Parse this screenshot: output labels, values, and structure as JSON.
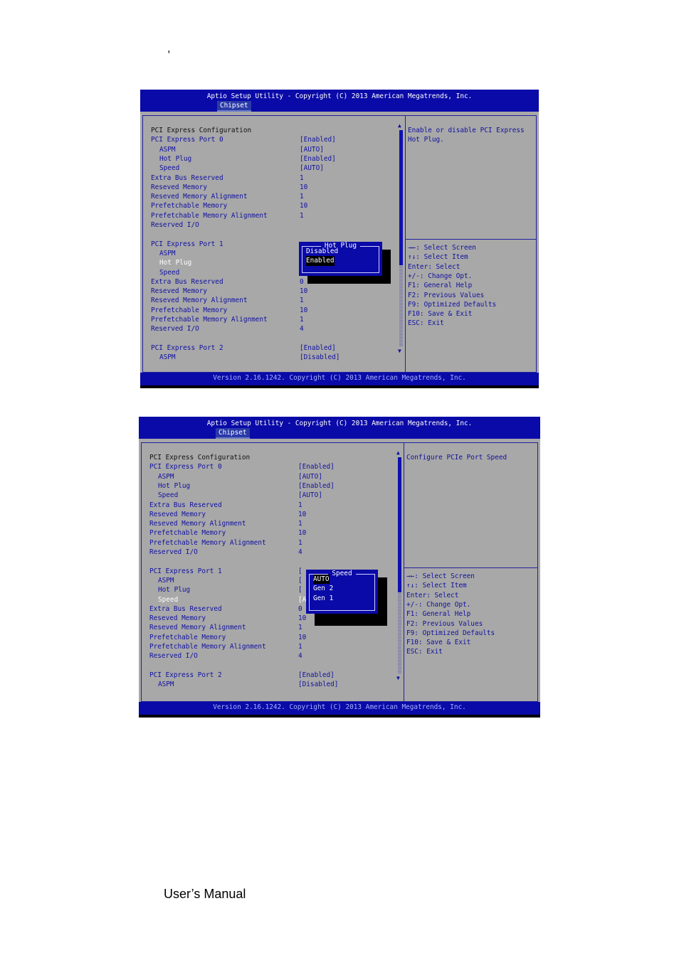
{
  "page": {
    "mark": ",",
    "footer": "User’s Manual"
  },
  "colors": {
    "bios_blue": "#0a0aa8",
    "bios_gray": "#a8a8a8",
    "item_text": "#1010a0",
    "selected_text": "#ffffff"
  },
  "screens": [
    {
      "title": "Aptio Setup Utility - Copyright (C) 2013 American Megatrends, Inc.",
      "tab": "Chipset",
      "footer": "Version 2.16.1242. Copyright (C) 2013 American Megatrends, Inc.",
      "rows": [
        {
          "label": "PCI Express Configuration",
          "value": "",
          "indent": false,
          "title": true
        },
        {
          "label": "PCI Express Port 0",
          "value": "[Enabled]",
          "indent": false
        },
        {
          "label": "ASPM",
          "value": "[AUTO]",
          "indent": true
        },
        {
          "label": "Hot Plug",
          "value": "[Enabled]",
          "indent": true
        },
        {
          "label": "Speed",
          "value": "[AUTO]",
          "indent": true
        },
        {
          "label": "Extra Bus Reserved",
          "value": "1",
          "indent": false
        },
        {
          "label": "Reseved Memory",
          "value": "10",
          "indent": false
        },
        {
          "label": "Reseved Memory Alignment",
          "value": "1",
          "indent": false
        },
        {
          "label": "Prefetchable Memory",
          "value": "10",
          "indent": false
        },
        {
          "label": "Prefetchable Memory Alignment",
          "value": "1",
          "indent": false
        },
        {
          "label": "Reserved I/O",
          "value": "",
          "indent": false
        },
        {
          "label": "",
          "value": "",
          "indent": false
        },
        {
          "label": "PCI Express Port 1",
          "value": "",
          "indent": false
        },
        {
          "label": "ASPM",
          "value": "",
          "indent": true
        },
        {
          "label": "Hot Plug",
          "value": "[",
          "indent": true,
          "selected": true
        },
        {
          "label": "Speed",
          "value": "[AUTO]",
          "indent": true
        },
        {
          "label": "Extra Bus Reserved",
          "value": "0",
          "indent": false
        },
        {
          "label": "Reseved Memory",
          "value": "10",
          "indent": false
        },
        {
          "label": "Reseved Memory Alignment",
          "value": "1",
          "indent": false
        },
        {
          "label": "Prefetchable Memory",
          "value": "10",
          "indent": false
        },
        {
          "label": "Prefetchable Memory Alignment",
          "value": "1",
          "indent": false
        },
        {
          "label": "Reserved I/O",
          "value": "4",
          "indent": false
        },
        {
          "label": "",
          "value": "",
          "indent": false
        },
        {
          "label": "PCI Express Port 2",
          "value": "[Enabled]",
          "indent": false
        },
        {
          "label": "ASPM",
          "value": "[Disabled]",
          "indent": true
        }
      ],
      "help": [
        "Enable or disable PCI Express",
        "Hot Plug."
      ],
      "keys": [
        "→←: Select Screen",
        "↑↓: Select Item",
        "Enter: Select",
        "+/-: Change Opt.",
        "F1: General Help",
        "F2: Previous Values",
        "F9: Optimized Defaults",
        "F10: Save & Exit",
        "ESC: Exit"
      ],
      "popup": {
        "title": "Hot Plug",
        "options": [
          "Disabled",
          "Enabled"
        ],
        "selected": 1
      }
    },
    {
      "title": "Aptio Setup Utility - Copyright (C) 2013 American Megatrends, Inc.",
      "tab": "Chipset",
      "footer": "Version 2.16.1242. Copyright (C) 2013 American Megatrends, Inc.",
      "rows": [
        {
          "label": "PCI Express Configuration",
          "value": "",
          "indent": false,
          "title": true
        },
        {
          "label": "PCI Express Port 0",
          "value": "[Enabled]",
          "indent": false
        },
        {
          "label": "ASPM",
          "value": "[AUTO]",
          "indent": true
        },
        {
          "label": "Hot Plug",
          "value": "[Enabled]",
          "indent": true
        },
        {
          "label": "Speed",
          "value": "[AUTO]",
          "indent": true
        },
        {
          "label": "Extra Bus Reserved",
          "value": "1",
          "indent": false
        },
        {
          "label": "Reseved Memory",
          "value": "10",
          "indent": false
        },
        {
          "label": "Reseved Memory Alignment",
          "value": "1",
          "indent": false
        },
        {
          "label": "Prefetchable Memory",
          "value": "10",
          "indent": false
        },
        {
          "label": "Prefetchable Memory Alignment",
          "value": "1",
          "indent": false
        },
        {
          "label": "Reserved I/O",
          "value": "4",
          "indent": false
        },
        {
          "label": "",
          "value": "",
          "indent": false
        },
        {
          "label": "PCI Express Port 1",
          "value": "[",
          "indent": false
        },
        {
          "label": "ASPM",
          "value": "[",
          "indent": true
        },
        {
          "label": "Hot Plug",
          "value": "[",
          "indent": true
        },
        {
          "label": "Speed",
          "value": "[AU",
          "indent": true,
          "selected": true
        },
        {
          "label": "Extra Bus Reserved",
          "value": "0",
          "indent": false
        },
        {
          "label": "Reseved Memory",
          "value": "10",
          "indent": false
        },
        {
          "label": "Reseved Memory Alignment",
          "value": "1",
          "indent": false
        },
        {
          "label": "Prefetchable Memory",
          "value": "10",
          "indent": false
        },
        {
          "label": "Prefetchable Memory Alignment",
          "value": "1",
          "indent": false
        },
        {
          "label": "Reserved I/O",
          "value": "4",
          "indent": false
        },
        {
          "label": "",
          "value": "",
          "indent": false
        },
        {
          "label": "PCI Express Port 2",
          "value": "[Enabled]",
          "indent": false
        },
        {
          "label": "ASPM",
          "value": "[Disabled]",
          "indent": true
        }
      ],
      "help": [
        "Configure PCIe Port Speed"
      ],
      "keys": [
        "→←: Select Screen",
        "↑↓: Select Item",
        "Enter: Select",
        "+/-: Change Opt.",
        "F1: General Help",
        "F2: Previous Values",
        "F9: Optimized Defaults",
        "F10: Save & Exit",
        "ESC: Exit"
      ],
      "popup": {
        "title": "Speed",
        "options": [
          "AUTO",
          "Gen 2",
          "Gen 1"
        ],
        "selected": 0
      }
    }
  ]
}
